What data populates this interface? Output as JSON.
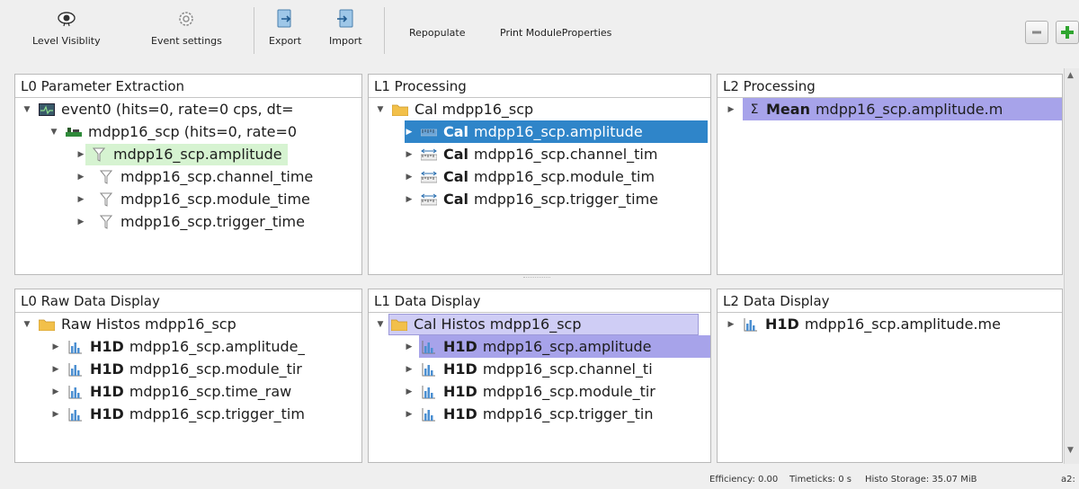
{
  "toolbar": {
    "level_visibility": "Level Visiblity",
    "event_settings": "Event settings",
    "export": "Export",
    "import": "Import",
    "repopulate": "Repopulate",
    "print_module_properties": "Print ModuleProperties"
  },
  "panels": {
    "l0_param": {
      "title": "L0 Parameter Extraction",
      "event": "event0 (hits=0, rate=0 cps, dt=",
      "module": "mdpp16_scp (hits=0, rate=0",
      "items": [
        "mdpp16_scp.amplitude",
        "mdpp16_scp.channel_time",
        "mdpp16_scp.module_time",
        "mdpp16_scp.trigger_time"
      ]
    },
    "l1_proc": {
      "title": "L1 Processing",
      "folder": "Cal mdpp16_scp",
      "cal_label": "Cal",
      "items": [
        "mdpp16_scp.amplitude",
        "mdpp16_scp.channel_tim",
        "mdpp16_scp.module_tim",
        "mdpp16_scp.trigger_time"
      ]
    },
    "l2_proc": {
      "title": "L2 Processing",
      "sigma": "Σ",
      "mean_label": "Mean",
      "item": "mdpp16_scp.amplitude.m"
    },
    "l0_raw": {
      "title": "L0 Raw Data Display",
      "folder": "Raw Histos mdpp16_scp",
      "h1d_label": "H1D",
      "items": [
        "mdpp16_scp.amplitude_",
        "mdpp16_scp.module_tir",
        "mdpp16_scp.time_raw",
        "mdpp16_scp.trigger_tim"
      ]
    },
    "l1_data": {
      "title": "L1 Data Display",
      "folder": "Cal Histos mdpp16_scp",
      "h1d_label": "H1D",
      "items": [
        "mdpp16_scp.amplitude",
        "mdpp16_scp.channel_ti",
        "mdpp16_scp.module_tir",
        "mdpp16_scp.trigger_tin"
      ]
    },
    "l2_data": {
      "title": "L2 Data Display",
      "h1d_label": "H1D",
      "item": "mdpp16_scp.amplitude.me"
    }
  },
  "status": {
    "efficiency": "Efficiency: 0.00",
    "timeticks": "Timeticks: 0 s",
    "histo_storage": "Histo Storage: 35.07 MiB",
    "cut": "a2:"
  },
  "colors": {
    "selection_blue": "#2f85c9",
    "highlight_green": "#d6f3d1",
    "highlight_purple": "#a7a3ea",
    "folder_yellow": "#f2c04a"
  }
}
